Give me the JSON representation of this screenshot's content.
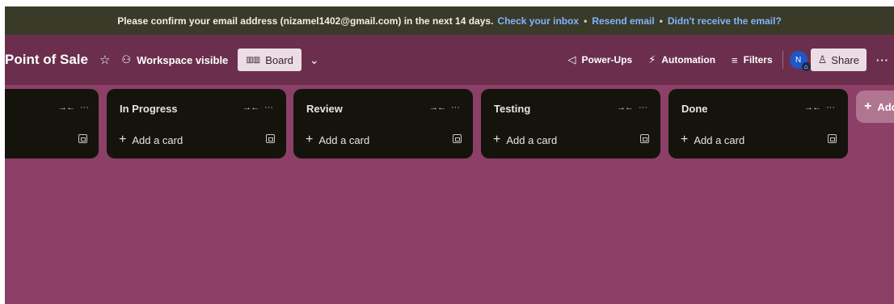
{
  "banner": {
    "message": "Please confirm your email address (nizamel1402@gmail.com) in the next 14 days.",
    "check_inbox": "Check your inbox",
    "resend": "Resend email",
    "not_received": "Didn't receive the email?",
    "separator": "•"
  },
  "board": {
    "title": "Point of Sale",
    "visibility": "Workspace visible",
    "view": "Board"
  },
  "toolbar": {
    "powerups": "Power-Ups",
    "automation": "Automation",
    "filters": "Filters",
    "avatar_initial": "N",
    "share": "Share"
  },
  "lists": [
    {
      "title": "",
      "add_label": ""
    },
    {
      "title": "In Progress",
      "add_label": "Add a card"
    },
    {
      "title": "Review",
      "add_label": "Add a card"
    },
    {
      "title": "Testing",
      "add_label": "Add a card"
    },
    {
      "title": "Done",
      "add_label": "Add a card"
    }
  ],
  "add_list_label": "Add",
  "icons": {
    "star": "star-icon",
    "visibility": "workspace-icon",
    "board": "board-icon",
    "chevron": "chevron-down-icon",
    "powerups": "rocket-icon",
    "automation": "lightning-icon",
    "filters": "filter-icon",
    "share": "person-add-icon",
    "more": "more-icon",
    "collapse": "collapse-icon",
    "menu": "ellipsis-icon",
    "template": "card-template-icon"
  },
  "colors": {
    "background": "#8c3f67",
    "topbar": "#6b2f4d",
    "banner": "#3a3a28",
    "list": "#14140c",
    "link": "#7fb4ff",
    "avatar": "#1f57c8"
  }
}
